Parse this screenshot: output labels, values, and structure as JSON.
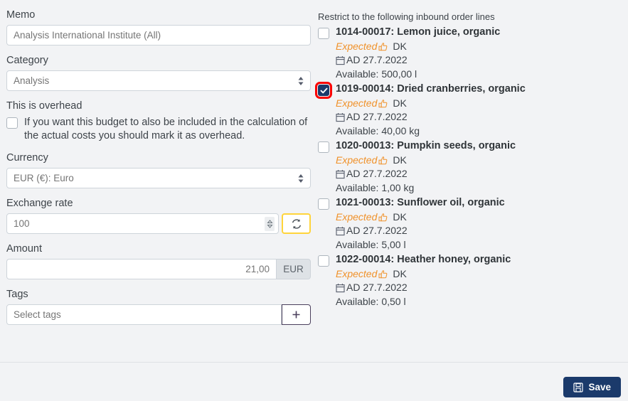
{
  "form": {
    "memo": {
      "label": "Memo",
      "placeholder": "Analysis International Institute (All)"
    },
    "category": {
      "label": "Category",
      "value": "Analysis"
    },
    "overhead": {
      "label": "This is overhead",
      "description": "If you want this budget to also be included in the calculation of the actual costs you should mark it as overhead.",
      "checked": false
    },
    "currency": {
      "label": "Currency",
      "value": "EUR (€): Euro"
    },
    "exchange_rate": {
      "label": "Exchange rate",
      "placeholder": "100",
      "refresh_icon": "refresh-icon"
    },
    "amount": {
      "label": "Amount",
      "value": "21,00",
      "unit": "EUR"
    },
    "tags": {
      "label": "Tags",
      "placeholder": "Select tags",
      "add_icon": "plus-icon"
    }
  },
  "lines": {
    "header": "Restrict to the following inbound order lines",
    "items": [
      {
        "title": "1014-00017: Lemon juice, organic",
        "status": "Expected",
        "country": "DK",
        "date": "AD 27.7.2022",
        "available": "Available: 500,00 l",
        "checked": false
      },
      {
        "title": "1019-00014: Dried cranberries, organic",
        "status": "Expected",
        "country": "DK",
        "date": "AD 27.7.2022",
        "available": "Available: 40,00 kg",
        "checked": true
      },
      {
        "title": "1020-00013: Pumpkin seeds, organic",
        "status": "Expected",
        "country": "DK",
        "date": "AD 27.7.2022",
        "available": "Available: 1,00 kg",
        "checked": false
      },
      {
        "title": "1021-00013: Sunflower oil, organic",
        "status": "Expected",
        "country": "DK",
        "date": "AD 27.7.2022",
        "available": "Available: 5,00 l",
        "checked": false
      },
      {
        "title": "1022-00014: Heather honey, organic",
        "status": "Expected",
        "country": "DK",
        "date": "AD 27.7.2022",
        "available": "Available: 0,50 l",
        "checked": false
      }
    ]
  },
  "footer": {
    "save_label": "Save",
    "save_icon": "save-floppy-icon"
  },
  "colors": {
    "background": "#f2f3f5",
    "accent_navy": "#1b3a6b",
    "status_orange": "#f0922b",
    "highlight_red": "#fa0000",
    "highlight_yellow": "#ffd43b",
    "tag_purple": "#4a3f5c"
  }
}
